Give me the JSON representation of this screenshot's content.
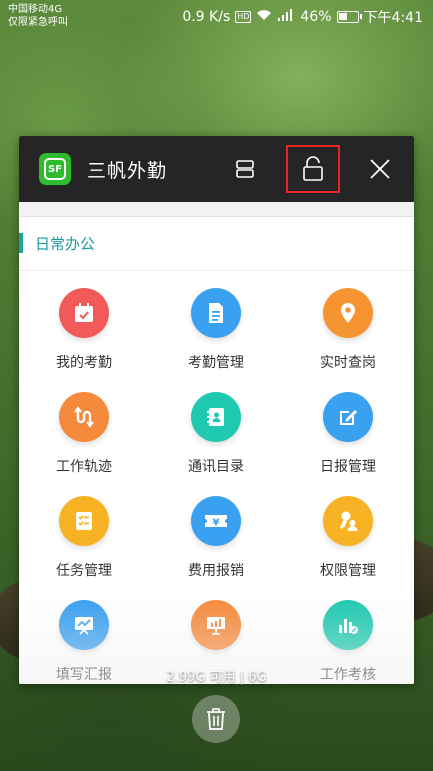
{
  "status_bar": {
    "carrier_line1": "中国移动4G",
    "carrier_line2": "仅限紧急呼叫",
    "speed": "0.9 K/s",
    "hd": "HD",
    "battery": "46%",
    "battery_level": 0.46,
    "time": "下午4:41"
  },
  "card": {
    "app_icon_text": "SF",
    "app_title": "三帆外勤",
    "header_icons": [
      "split-screen-icon",
      "lock-icon",
      "close-icon"
    ],
    "section_title": "日常办公",
    "tiles": [
      {
        "label": "我的考勤",
        "icon": "calendar-icon",
        "color": "#f25a5a"
      },
      {
        "label": "考勤管理",
        "icon": "document-icon",
        "color": "#3aa0f0"
      },
      {
        "label": "实时查岗",
        "icon": "location-pin-icon",
        "color": "#f79432"
      },
      {
        "label": "工作轨迹",
        "icon": "route-icon",
        "color": "#f58a3c"
      },
      {
        "label": "通讯目录",
        "icon": "contacts-icon",
        "color": "#1fc9b0"
      },
      {
        "label": "日报管理",
        "icon": "edit-icon",
        "color": "#3aa0f0"
      },
      {
        "label": "任务管理",
        "icon": "checklist-icon",
        "color": "#f7b323"
      },
      {
        "label": "费用报销",
        "icon": "yen-ticket-icon",
        "color": "#3aa0f0"
      },
      {
        "label": "权限管理",
        "icon": "key-user-icon",
        "color": "#f7b323"
      },
      {
        "label": "填写汇报",
        "icon": "chart-board-icon",
        "color": "#3aa0f0"
      },
      {
        "label": "",
        "icon": "presentation-icon",
        "color": "#f58a3c"
      },
      {
        "label": "工作考核",
        "icon": "stats-icon",
        "color": "#1fc9b0"
      }
    ]
  },
  "memory_text": "2.99G 可用 | 6G"
}
